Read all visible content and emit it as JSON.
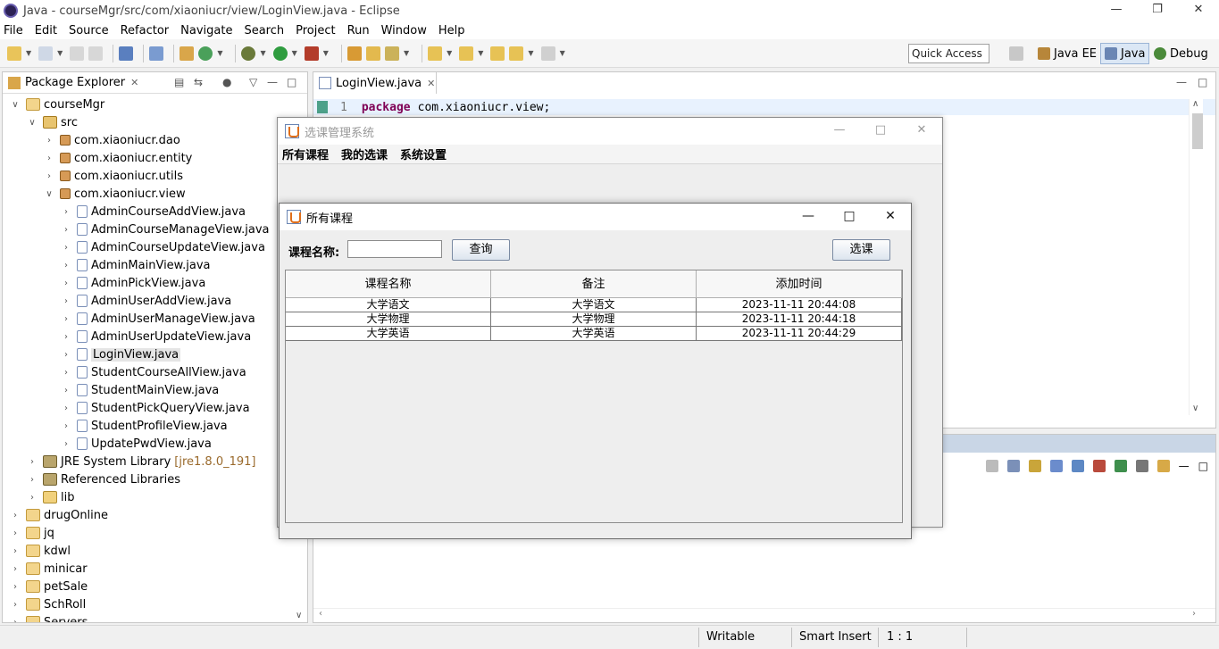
{
  "window": {
    "title": "Java - courseMgr/src/com/xiaoniucr/view/LoginView.java - Eclipse"
  },
  "menu": [
    "File",
    "Edit",
    "Source",
    "Refactor",
    "Navigate",
    "Search",
    "Project",
    "Run",
    "Window",
    "Help"
  ],
  "toolbar": {
    "quick_access_placeholder": "Quick Access",
    "perspectives": [
      "Java EE",
      "Java",
      "Debug"
    ]
  },
  "package_explorer": {
    "title": "Package Explorer",
    "tree": [
      {
        "label": "courseMgr",
        "level": 0,
        "expanded": true,
        "icon": "project"
      },
      {
        "label": "src",
        "level": 1,
        "expanded": true,
        "icon": "source-folder"
      },
      {
        "label": "com.xiaoniucr.dao",
        "level": 2,
        "expanded": false,
        "icon": "package"
      },
      {
        "label": "com.xiaoniucr.entity",
        "level": 2,
        "expanded": false,
        "icon": "package"
      },
      {
        "label": "com.xiaoniucr.utils",
        "level": 2,
        "expanded": false,
        "icon": "package"
      },
      {
        "label": "com.xiaoniucr.view",
        "level": 2,
        "expanded": true,
        "icon": "package"
      },
      {
        "label": "AdminCourseAddView.java",
        "level": 3,
        "expanded": false,
        "icon": "java-file"
      },
      {
        "label": "AdminCourseManageView.java",
        "level": 3,
        "expanded": false,
        "icon": "java-file"
      },
      {
        "label": "AdminCourseUpdateView.java",
        "level": 3,
        "expanded": false,
        "icon": "java-file"
      },
      {
        "label": "AdminMainView.java",
        "level": 3,
        "expanded": false,
        "icon": "java-file"
      },
      {
        "label": "AdminPickView.java",
        "level": 3,
        "expanded": false,
        "icon": "java-file"
      },
      {
        "label": "AdminUserAddView.java",
        "level": 3,
        "expanded": false,
        "icon": "java-file"
      },
      {
        "label": "AdminUserManageView.java",
        "level": 3,
        "expanded": false,
        "icon": "java-file"
      },
      {
        "label": "AdminUserUpdateView.java",
        "level": 3,
        "expanded": false,
        "icon": "java-file"
      },
      {
        "label": "LoginView.java",
        "level": 3,
        "expanded": false,
        "icon": "java-file",
        "selected": true
      },
      {
        "label": "StudentCourseAllView.java",
        "level": 3,
        "expanded": false,
        "icon": "java-file"
      },
      {
        "label": "StudentMainView.java",
        "level": 3,
        "expanded": false,
        "icon": "java-file"
      },
      {
        "label": "StudentPickQueryView.java",
        "level": 3,
        "expanded": false,
        "icon": "java-file"
      },
      {
        "label": "StudentProfileView.java",
        "level": 3,
        "expanded": false,
        "icon": "java-file"
      },
      {
        "label": "UpdatePwdView.java",
        "level": 3,
        "expanded": false,
        "icon": "java-file"
      },
      {
        "label": "JRE System Library",
        "tag": "[jre1.8.0_191]",
        "level": 1,
        "expanded": false,
        "icon": "library"
      },
      {
        "label": "Referenced Libraries",
        "level": 1,
        "expanded": false,
        "icon": "library"
      },
      {
        "label": "lib",
        "level": 1,
        "expanded": false,
        "icon": "folder"
      },
      {
        "label": "drugOnline",
        "level": 0,
        "expanded": false,
        "icon": "project"
      },
      {
        "label": "jq",
        "level": 0,
        "expanded": false,
        "icon": "project"
      },
      {
        "label": "kdwl",
        "level": 0,
        "expanded": false,
        "icon": "project"
      },
      {
        "label": "minicar",
        "level": 0,
        "expanded": false,
        "icon": "project"
      },
      {
        "label": "petSale",
        "level": 0,
        "expanded": false,
        "icon": "project"
      },
      {
        "label": "SchRoll",
        "level": 0,
        "expanded": false,
        "icon": "project"
      },
      {
        "label": "Servers",
        "level": 0,
        "expanded": false,
        "icon": "project"
      }
    ]
  },
  "editor": {
    "tab": "LoginView.java",
    "line_number": "1",
    "keyword": "package",
    "code": "com.xiaoniucr.view;"
  },
  "status_bar": {
    "writable": "Writable",
    "insert_mode": "Smart Insert",
    "position": "1 : 1"
  },
  "course_frame": {
    "title": "选课管理系统",
    "menu": [
      "所有课程",
      "我的选课",
      "系统设置"
    ]
  },
  "internal_frame": {
    "title": "所有课程",
    "search_label": "课程名称:",
    "search_value": "",
    "query_button": "查询",
    "pick_button": "选课",
    "table": {
      "headers": [
        "课程名称",
        "备注",
        "添加时间"
      ],
      "rows": [
        [
          "大学语文",
          "大学语文",
          "2023-11-11 20:44:08"
        ],
        [
          "大学物理",
          "大学物理",
          "2023-11-11 20:44:18"
        ],
        [
          "大学英语",
          "大学英语",
          "2023-11-11 20:44:29"
        ]
      ]
    }
  },
  "colors": {
    "keyword": "#7f0055",
    "java_perspective_bg": "#dbe7f5",
    "editor_current_line": "#e8f2fe"
  }
}
